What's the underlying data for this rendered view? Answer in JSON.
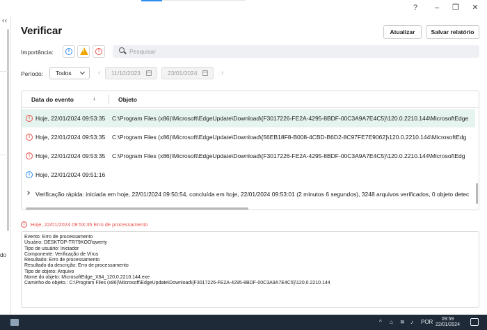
{
  "window": {
    "help": "?",
    "minimize": "–",
    "restore": "❐",
    "close": "✕"
  },
  "rail": {
    "collapse": "‹‹",
    "partial_text": "do"
  },
  "header": {
    "title": "Verificar",
    "update_button": "Atualizar",
    "save_report_button": "Salvar relatório"
  },
  "filters": {
    "importance_label": "Importância:",
    "search_placeholder": "Pesquisar",
    "period_label": "Período:",
    "period_value": "Todos",
    "date_from": "11/10/2023",
    "date_to": "23/01/2024"
  },
  "table": {
    "col_date": "Data do evento",
    "col_object": "Objeto",
    "sort_glyph": "↓",
    "rows": [
      {
        "date": "Hoje, 22/01/2024 09:53:35",
        "object": "C:\\Program Files (x86)\\Microsoft\\EdgeUpdate\\Download\\{F3017226-FE2A-4295-8BDF-00C3A9A7E4C5}\\120.0.2210.144\\MicrosoftEdge"
      },
      {
        "date": "Hoje, 22/01/2024 09:53:35",
        "object": "C:\\Program Files (x86)\\Microsoft\\EdgeUpdate\\Download\\{56EB18F8-B008-4CBD-B6D2-8C97FE7E9062}\\120.0.2210.144\\MicrosoftEdg"
      },
      {
        "date": "Hoje, 22/01/2024 09:53:35",
        "object": "C:\\Program Files (x86)\\Microsoft\\EdgeUpdate\\Download\\{F3017226-FE2A-4295-8BDF-00C3A9A7E4C5}\\120.0.2210.144\\MicrosoftEdg"
      },
      {
        "date": "Hoje, 22/01/2024 09:51:16",
        "object": ""
      }
    ],
    "summary": "Verificação rápida: iniciada em hoje, 22/01/2024 09:50:54, concluída em hoje, 22/01/2024 09:53:01 (2 minutos 6 segundos), 3248 arquivos verificados, 0 objeto detec"
  },
  "details": {
    "title": "Hoje, 22/01/2024 09:53:35 Erro de processamento",
    "lines": [
      "Evento: Erro de processamento",
      "Usuário: DESKTOP-TR79KOO\\qwerty",
      "Tipo de usuário: Iniciador",
      "Componente: Verificação de Vírus",
      "Resultado: Erro de processamento",
      "Resultado da descrição: Erro de processamento",
      "Tipo de objeto: Arquivo",
      "Nome do objeto: MicrosoftEdge_X64_120.0.2210.144.exe",
      "Caminho do objeto.: C:\\Program Files (x86)\\Microsoft\\EdgeUpdate\\Download\\{F3017226-FE2A-4295-8BDF-00C3A9A7E4C5}\\120.0.2210.144"
    ]
  },
  "taskbar": {
    "tray_chevron": "^",
    "language": "POR",
    "time": "09:59",
    "date": "22/01/2024"
  },
  "colors": {
    "accent": "#2d8cf0",
    "error": "#e8504a",
    "warning": "#f0a800",
    "selected_row": "#e6f4ef",
    "taskbar": "#1e2a38"
  }
}
